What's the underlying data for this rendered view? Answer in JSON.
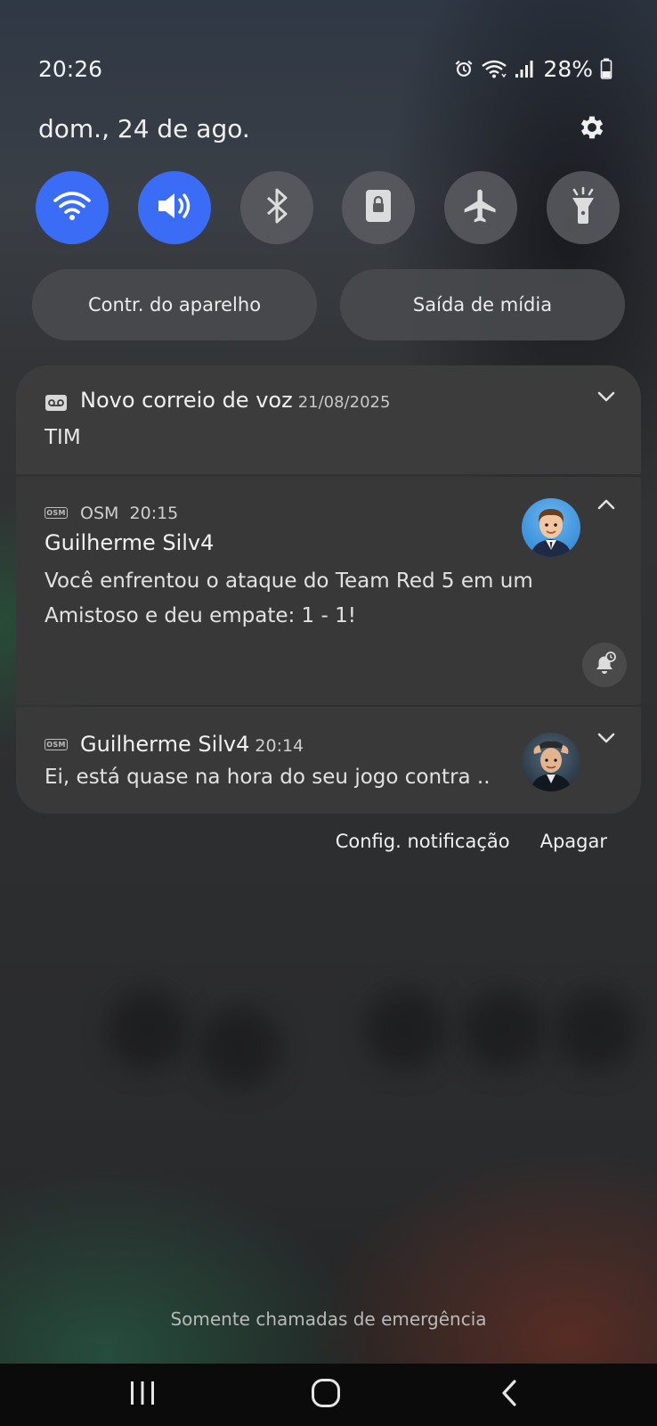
{
  "status_bar": {
    "time": "20:26",
    "battery": "28%",
    "icons": [
      "alarm-icon",
      "wifi-icon",
      "signal-icon",
      "battery-icon"
    ]
  },
  "header": {
    "date": "dom., 24 de ago.",
    "settings_icon": "gear-icon"
  },
  "quick_toggles": [
    {
      "icon": "wifi-icon",
      "active": true
    },
    {
      "icon": "sound-icon",
      "active": true
    },
    {
      "icon": "bluetooth-icon",
      "active": false
    },
    {
      "icon": "rotation-lock-icon",
      "active": false
    },
    {
      "icon": "airplane-icon",
      "active": false
    },
    {
      "icon": "flashlight-icon",
      "active": false
    }
  ],
  "pills": {
    "device_control": "Contr. do aparelho",
    "media_output": "Saída de mídia"
  },
  "notifications": [
    {
      "app_icon": "voicemail-icon",
      "title": "Novo correio de voz",
      "date": "21/08/2025",
      "body": "TIM"
    },
    {
      "app": "OSM",
      "time": "20:15",
      "title": "Guilherme Silv4",
      "body": "Você enfrentou o ataque do Team Red 5 em um Amistoso e deu empate: 1 - 1!"
    },
    {
      "title": "Guilherme Silv4",
      "time": "20:14",
      "body": "Ei, está quase na hora do seu jogo contra .."
    }
  ],
  "notification_actions": {
    "settings": "Config. notificação",
    "clear": "Apagar"
  },
  "footer": {
    "emergency": "Somente chamadas de emergência"
  },
  "colors": {
    "accent": "#3a6cf6",
    "card": "#3b3b3b"
  }
}
